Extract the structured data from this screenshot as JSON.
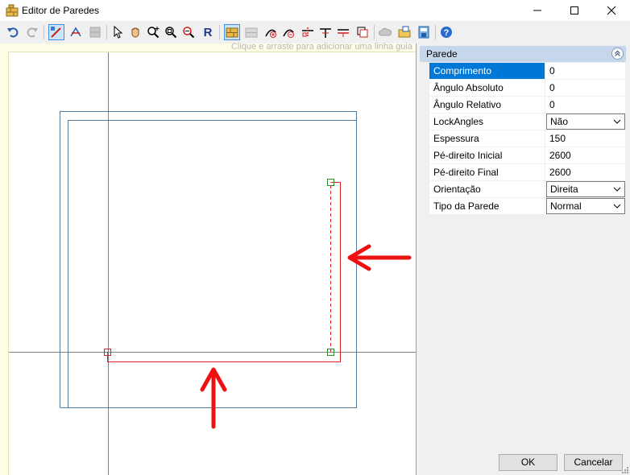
{
  "window": {
    "title": "Editor de Paredes",
    "icon": "wall-editor-icon",
    "controls": [
      "minimize-icon",
      "maximize-icon",
      "close-icon"
    ]
  },
  "toolbar": {
    "buttons": [
      {
        "name": "undo-icon",
        "enabled": true
      },
      {
        "name": "redo-icon",
        "enabled": false
      },
      {
        "name": "draw-wall-icon",
        "enabled": true,
        "active": true
      },
      {
        "name": "edit-wall-icon",
        "enabled": true
      },
      {
        "name": "wall-block-icon",
        "enabled": false
      },
      {
        "name": "pointer-icon",
        "enabled": true
      },
      {
        "name": "pan-hand-icon",
        "enabled": true
      },
      {
        "name": "zoom-in-icon",
        "enabled": true
      },
      {
        "name": "zoom-window-icon",
        "enabled": true
      },
      {
        "name": "zoom-out-icon",
        "enabled": true
      },
      {
        "name": "reset-view-icon",
        "enabled": true,
        "glyph": "R"
      },
      {
        "name": "snap-grid-icon",
        "enabled": true,
        "active": true
      },
      {
        "name": "snap-points-icon",
        "enabled": false
      },
      {
        "name": "add-node-icon",
        "enabled": true
      },
      {
        "name": "remove-node-icon",
        "enabled": true
      },
      {
        "name": "split-wall-icon",
        "enabled": true
      },
      {
        "name": "join-wall-icon",
        "enabled": true
      },
      {
        "name": "wall-offset-icon",
        "enabled": true
      },
      {
        "name": "copy-layout-icon",
        "enabled": true
      },
      {
        "name": "cloud-icon",
        "enabled": false
      },
      {
        "name": "import-icon",
        "enabled": true
      },
      {
        "name": "export-icon",
        "enabled": true
      },
      {
        "name": "help-icon",
        "enabled": true,
        "glyph": "?"
      }
    ]
  },
  "canvas": {
    "hint": "Clique e arraste para adicionar uma linha guia",
    "colors": {
      "guide": "#808080",
      "outer_wall": "#4f7d9b",
      "selected_wall": "#e02020",
      "arrow": "#ee1111",
      "node_green": "#2e8b2e"
    }
  },
  "properties": {
    "section_title": "Parede",
    "rows": [
      {
        "label": "Comprimento",
        "value": "0",
        "selected": true
      },
      {
        "label": "Ângulo Absoluto",
        "value": "0"
      },
      {
        "label": "Ângulo Relativo",
        "value": "0"
      },
      {
        "label": "LockAngles",
        "value": "Não",
        "dropdown": true
      },
      {
        "label": "Espessura",
        "value": "150"
      },
      {
        "label": "Pé-direito Inicial",
        "value": "2600"
      },
      {
        "label": "Pé-direito Final",
        "value": "2600"
      },
      {
        "label": "Orientação",
        "value": "Direita",
        "dropdown": true
      },
      {
        "label": "Tipo da Parede",
        "value": "Normal",
        "dropdown": true
      }
    ]
  },
  "footer": {
    "ok_label": "OK",
    "cancel_label": "Cancelar"
  }
}
